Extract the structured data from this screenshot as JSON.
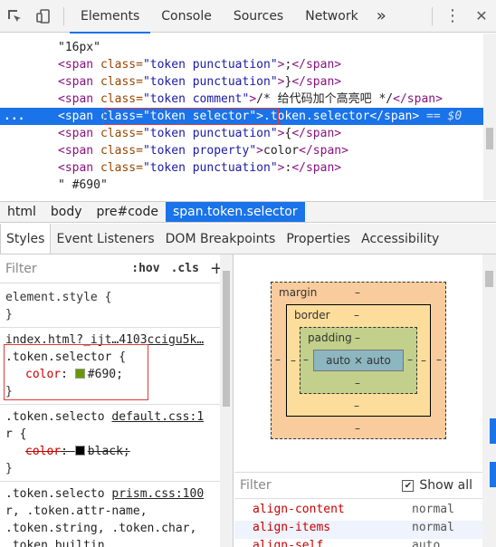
{
  "toolbar": {
    "tabs": [
      "Elements",
      "Console",
      "Sources",
      "Network"
    ],
    "more": "»",
    "menu": "⋮",
    "close": "✕"
  },
  "tree": {
    "lines": [
      {
        "html": "\"16px\""
      },
      {
        "t1": "<span ",
        "a": "class=",
        "v": "\"token punctuation\"",
        "t2": ">",
        "x": ";",
        "t3": "</span>"
      },
      {
        "t1": "<span ",
        "a": "class=",
        "v": "\"token punctuation\"",
        "t2": ">",
        "x": "}",
        "t3": "</span>"
      },
      {
        "t1": "<span ",
        "a": "class=",
        "v": "\"token comment\"",
        "t2": ">",
        "x": "/* 给代码加个高亮吧 */",
        "t3": "</span>"
      },
      {
        "t1": "<span ",
        "a": "class=",
        "v": "\"token selector\"",
        "t2": ">",
        "x": ".token.selector",
        "t3": "</span>",
        "extra": " == $0"
      },
      {
        "t1": "<span ",
        "a": "class=",
        "v": "\"token punctuation\"",
        "t2": ">",
        "x": "{",
        "t3": "</span>"
      },
      {
        "t1": "<span ",
        "a": "class=",
        "v": "\"token property\"",
        "t2": ">",
        "x": "color",
        "t3": "</span>"
      },
      {
        "t1": "<span ",
        "a": "class=",
        "v": "\"token punctuation\"",
        "t2": ">",
        "x": ":",
        "t3": "</span>"
      },
      {
        "html": "\" #690\""
      }
    ],
    "ellipsis": "..."
  },
  "breadcrumbs": [
    "html",
    "body",
    "pre#code",
    "span.token.selector"
  ],
  "subtabs": [
    "Styles",
    "Event Listeners",
    "DOM Breakpoints",
    "Properties",
    "Accessibility"
  ],
  "styles": {
    "filter_placeholder": "Filter",
    "hov": ":hov",
    "cls": ".cls",
    "plus": "+",
    "element_style": "element.style {",
    "close_brace": "}",
    "rule1_source": "index.html?_ijt…4103ccigu5k…",
    "rule1_selector": ".token.selector {",
    "rule1_prop": "color",
    "rule1_value": "#690;",
    "rule1_color": "#669900",
    "rule2_selector_a": ".token.selecto",
    "rule2_source": "default.css:1",
    "rule2_selector_b": "r {",
    "rule2_prop": "color",
    "rule2_value": "black;",
    "rule3_selector_a": ".token.selecto",
    "rule3_source": "prism.css:100",
    "rule3_selector_b": "r, .token.attr-name,",
    "rule3_selector_c": ".token.string, .token.char,",
    "rule3_selector_d": ".token.builtin,"
  },
  "boxmodel": {
    "margin": "margin",
    "border": "border",
    "padding": "padding",
    "content": "auto × auto",
    "dash": "–",
    "filter_placeholder": "Filter",
    "show_all": "Show all",
    "computed": [
      {
        "prop": "align-content",
        "val": "normal"
      },
      {
        "prop": "align-items",
        "val": "normal"
      },
      {
        "prop": "align-self",
        "val": "auto"
      }
    ]
  }
}
